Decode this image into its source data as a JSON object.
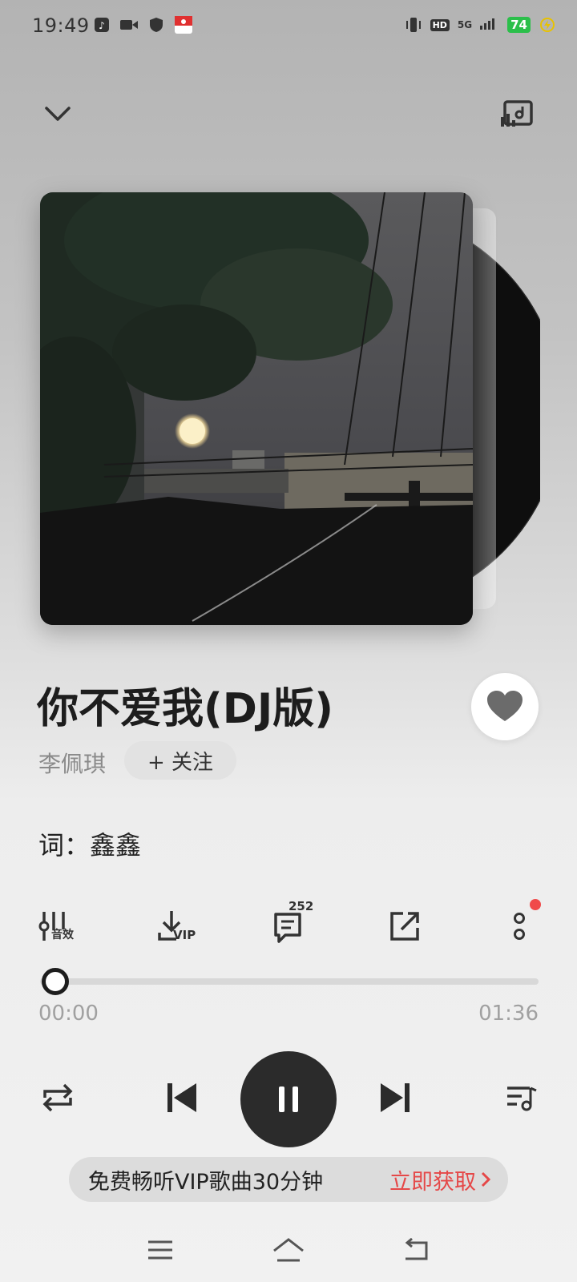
{
  "status": {
    "time": "19:49",
    "network": "5G",
    "hd": "HD",
    "battery": "74"
  },
  "song": {
    "title": "你不爱我(DJ版)",
    "artist": "李佩琪",
    "follow_label": "+ 关注",
    "lyricist": "词：鑫鑫"
  },
  "tools": {
    "effects_label": "音效",
    "download_label": "VIP",
    "comment_count": "252"
  },
  "progress": {
    "current": "00:00",
    "total": "01:36",
    "fraction": 0.0
  },
  "promo": {
    "text": "免费畅听VIP歌曲30分钟",
    "action": "立即获取"
  },
  "colors": {
    "accent": "#e54848",
    "play_button": "#2b2b2b",
    "battery": "#2bbf4a"
  },
  "icons": [
    "chevron-down-icon",
    "cast-icon",
    "effects-icon",
    "download-icon",
    "comment-icon",
    "share-icon",
    "more-icon",
    "repeat-icon",
    "previous-icon",
    "pause-icon",
    "next-icon",
    "playlist-icon",
    "heart-icon",
    "menu-icon",
    "home-icon",
    "back-icon"
  ]
}
